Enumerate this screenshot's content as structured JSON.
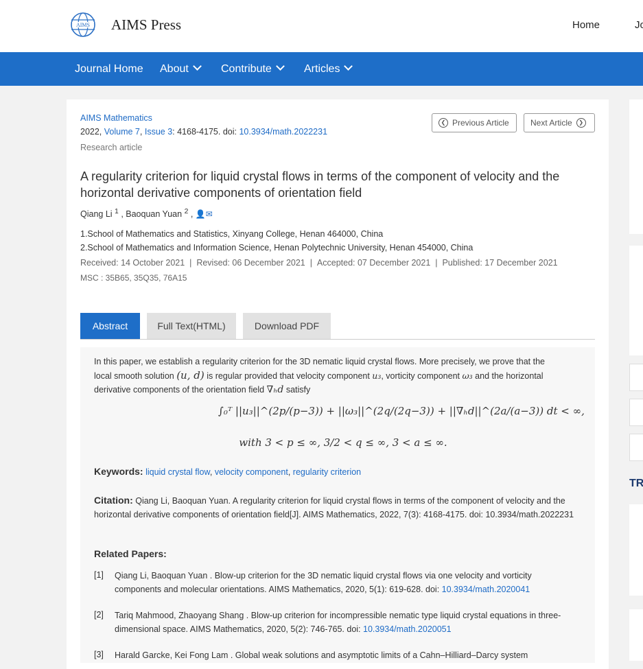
{
  "header": {
    "brand": "AIMS Press",
    "logo_text": "AIMS",
    "nav": [
      "Home",
      "Jo"
    ]
  },
  "navbar": {
    "items": [
      "Journal Home",
      "About",
      "Contribute",
      "Articles"
    ]
  },
  "article": {
    "journal": "AIMS Mathematics",
    "year": "2022, ",
    "volume": "Volume 7",
    "issue": "Issue 3",
    "pages": ": 4168-4175. doi: ",
    "doi": "10.3934/math.2022231",
    "type": "Research article",
    "prev_label": "Previous Article",
    "next_label": "Next Article",
    "title": "A regularity criterion for liquid crystal flows in terms of the component of velocity and the horizontal derivative components of orientation field",
    "authors": [
      {
        "name": "Qiang Li",
        "sup": "1"
      },
      {
        "name": "Baoquan Yuan",
        "sup": "2"
      }
    ],
    "affiliations": [
      "1.School of Mathematics and Statistics, Xinyang College, Henan 464000, China",
      "2.School of Mathematics and Information Science, Henan Polytechnic University, Henan 454000, China"
    ],
    "dates": {
      "received": "Received: 14 October 2021",
      "revised": "Revised: 06 December 2021",
      "accepted": "Accepted: 07 December 2021",
      "published": "Published: 17 December 2021"
    },
    "msc": "MSC : 35B65, 35Q35, 76A15"
  },
  "tabs": [
    "Abstract",
    "Full Text(HTML)",
    "Download PDF"
  ],
  "abstract": {
    "text1": "In this paper, we establish a regularity criterion for the 3D nematic liquid crystal flows. More precisely, we prove that the",
    "text2a": "local smooth solution ",
    "text2_math1": "(u, d)",
    "text2b": " is regular provided that velocity component ",
    "text2_math2": "u₃",
    "text2c": ", vorticity component ",
    "text2_math3": "ω₃",
    "text2d": " and the horizontal",
    "text3a": "derivative components of the orientation field ",
    "text3_math": "∇ₕd",
    "text3b": " satisfy",
    "formula1": "∫₀ᵀ ||u₃||^(2p/(p−3)) + ||ω₃||^(2q/(2q−3)) + ||∇ₕd||^(2a/(a−3)) dt < ∞,",
    "formula2": "with  3 < p ≤ ∞,  3/2 < q ≤ ∞,  3 < a ≤ ∞."
  },
  "keywords": {
    "label": "Keywords:",
    "items": [
      "liquid crystal flow",
      "velocity component",
      "regularity criterion"
    ]
  },
  "citation": {
    "label": "Citation:",
    "text": "Qiang Li, Baoquan Yuan. A regularity criterion for liquid crystal flows in terms of the component of velocity and the horizontal derivative components of orientation field[J]. AIMS Mathematics, 2022, 7(3): 4168-4175. doi: 10.3934/math.2022231"
  },
  "related": {
    "label": "Related Papers:",
    "items": [
      {
        "num": "[1]",
        "text": "Qiang Li, Baoquan Yuan . Blow-up criterion for the 3D nematic liquid crystal flows via one velocity and vorticity components and molecular orientations. AIMS Mathematics, 2020, 5(1): 619-628. doi: ",
        "doi": "10.3934/math.2020041"
      },
      {
        "num": "[2]",
        "text": "Tariq Mahmood, Zhaoyang Shang . Blow-up criterion for incompressible nematic type liquid crystal equations in three-dimensional space. AIMS Mathematics, 2020, 5(2): 746-765. doi: ",
        "doi": "10.3934/math.2020051"
      },
      {
        "num": "[3]",
        "text": "Harald Garcke, Kei Fong Lam . Global weak solutions and asymptotic limits of a Cahn–Hilliard–Darcy system",
        "doi": ""
      }
    ]
  },
  "sidebar": {
    "heading": "TR"
  },
  "colors": {
    "nav_bg": "#1e6ec8",
    "link": "#1e6bc6",
    "active_tab": "#1e6ec8",
    "inactive_tab": "#e2e2e2"
  }
}
